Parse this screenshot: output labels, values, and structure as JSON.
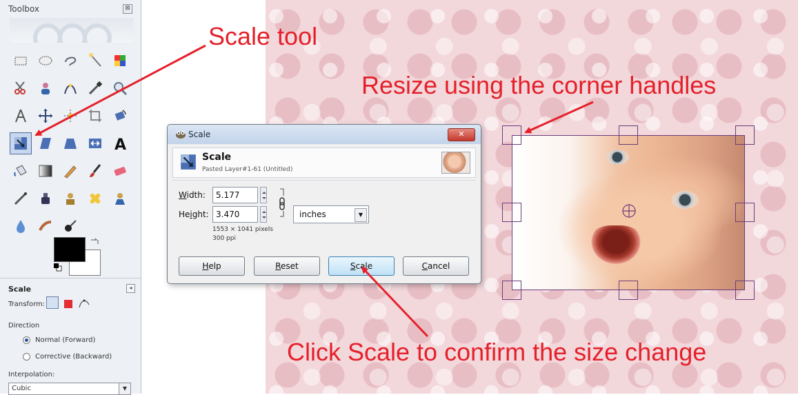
{
  "toolbox": {
    "title": "Toolbox",
    "close_glyph": "⊠",
    "tools": [
      {
        "icon": "rect-select-icon"
      },
      {
        "icon": "ellipse-select-icon"
      },
      {
        "icon": "free-select-icon"
      },
      {
        "icon": "fuzzy-select-icon"
      },
      {
        "icon": "by-color-select-icon"
      },
      {
        "icon": "scissors-select-icon"
      },
      {
        "icon": "foreground-select-icon"
      },
      {
        "icon": "paths-icon"
      },
      {
        "icon": "color-picker-icon"
      },
      {
        "icon": "zoom-icon"
      },
      {
        "icon": "measure-icon"
      },
      {
        "icon": "move-icon"
      },
      {
        "icon": "align-icon"
      },
      {
        "icon": "crop-icon"
      },
      {
        "icon": "rotate-icon"
      },
      {
        "icon": "scale-icon",
        "active": true
      },
      {
        "icon": "shear-icon"
      },
      {
        "icon": "perspective-icon"
      },
      {
        "icon": "flip-icon"
      },
      {
        "icon": "text-icon"
      },
      {
        "icon": "bucket-fill-icon"
      },
      {
        "icon": "blend-icon"
      },
      {
        "icon": "pencil-icon"
      },
      {
        "icon": "paintbrush-icon"
      },
      {
        "icon": "eraser-icon"
      },
      {
        "icon": "airbrush-icon"
      },
      {
        "icon": "ink-icon"
      },
      {
        "icon": "clone-icon"
      },
      {
        "icon": "heal-icon"
      },
      {
        "icon": "perspective-clone-icon"
      },
      {
        "icon": "blur-sharpen-icon"
      },
      {
        "icon": "smudge-icon"
      },
      {
        "icon": "dodge-burn-icon"
      }
    ],
    "colors": {
      "foreground": "#000000",
      "background": "#ffffff"
    },
    "options": {
      "title": "Scale",
      "collapse_glyph": "◂",
      "transform_label": "Transform:",
      "direction_label": "Direction",
      "direction_options": [
        {
          "label": "Normal (Forward)",
          "selected": true
        },
        {
          "label": "Corrective (Backward)",
          "selected": false
        }
      ],
      "interpolation_label": "Interpolation:",
      "interpolation_value": "Cubic"
    }
  },
  "dialog": {
    "title": "Scale",
    "close_glyph": "✕",
    "header_title": "Scale",
    "header_subtitle": "Pasted Layer#1-61 (Untitled)",
    "width_label_prefix": "W",
    "width_label_rest": "idth:",
    "width_value": "5.177",
    "height_label_prefix": "He",
    "height_label_underlined": "i",
    "height_label_rest": "ght:",
    "height_value": "3.470",
    "unit": "inches",
    "pixel_size": "1553 × 1041 pixels",
    "resolution": "300 ppi",
    "buttons": {
      "help": {
        "underlined": "H",
        "rest": "elp"
      },
      "reset": {
        "underlined": "R",
        "rest": "eset"
      },
      "scale": {
        "underlined": "S",
        "rest": "cale"
      },
      "cancel": {
        "underlined": "C",
        "rest": "ancel"
      }
    }
  },
  "annotations": {
    "scale_tool": "Scale tool",
    "resize": "Resize using the corner handles",
    "confirm": "Click Scale to confirm the size change",
    "color": "#e5202a"
  }
}
